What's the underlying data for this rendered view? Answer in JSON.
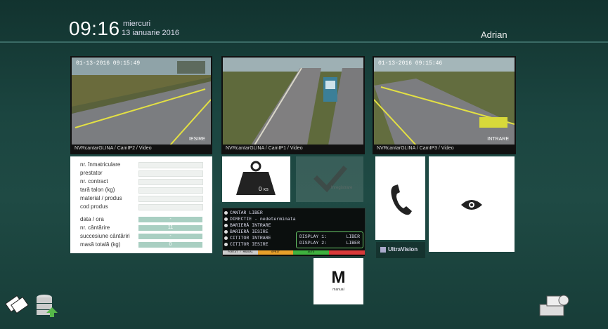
{
  "header": {
    "time": "09:16",
    "day": "miercuri",
    "date": "13 ianuarie 2016",
    "user": "Adrian"
  },
  "cameras": [
    {
      "timestamp": "01-13-2016 09:15:49",
      "caption": "NVRcantarGLINA / CamIP2 / Video",
      "corner": "IESIRE"
    },
    {
      "timestamp": "",
      "caption": "NVRcantarGLINA / CamIP1 / Video",
      "corner": ""
    },
    {
      "timestamp": "01-13-2016 09:15:46",
      "caption": "NVRcantarGLINA / CamIP3 / Video",
      "corner": "INTRARE"
    }
  ],
  "form": {
    "fields": [
      "nr. înmatriculare",
      "prestator",
      "nr. contract",
      "tară talon (kg)",
      "material / produs",
      "cod produs"
    ],
    "stats": [
      {
        "label": "data / ora",
        "value": "-"
      },
      {
        "label": "nr. cântărire",
        "value": "11"
      },
      {
        "label": "succesiune cântăriri",
        "value": "-"
      },
      {
        "label": "masă totală (kg)",
        "value": "0"
      }
    ]
  },
  "weight": {
    "value": "0",
    "unit": "KG"
  },
  "confirm": {
    "label": "Inregistrare"
  },
  "status": {
    "lines": [
      "CANTAR LIBER",
      "DIRECTIE - nedeterminata",
      "BARIERĂ INTRARE",
      "BARIERĂ IESIRE",
      "CITITOR INTRARE",
      "CITITOR IESIRE"
    ],
    "display": [
      {
        "label": "DISPLAY 1:",
        "value": "LIBER"
      },
      {
        "label": "DISPLAY 2:",
        "value": "LIBER"
      }
    ],
    "segments": [
      "FORTAT / MANUAL",
      "OPRIT",
      "AUTO",
      ""
    ],
    "colors": [
      "#cccccc",
      "#e8a02a",
      "#3fb13f",
      "#d83a3a"
    ]
  },
  "manual": {
    "letter": "M",
    "label": "manual"
  },
  "brand": "UltraVision",
  "icons": [
    "cards-icon",
    "database-upload-icon",
    "phone-icon",
    "eye-icon",
    "weight-icon",
    "check-icon",
    "printer-icon"
  ]
}
